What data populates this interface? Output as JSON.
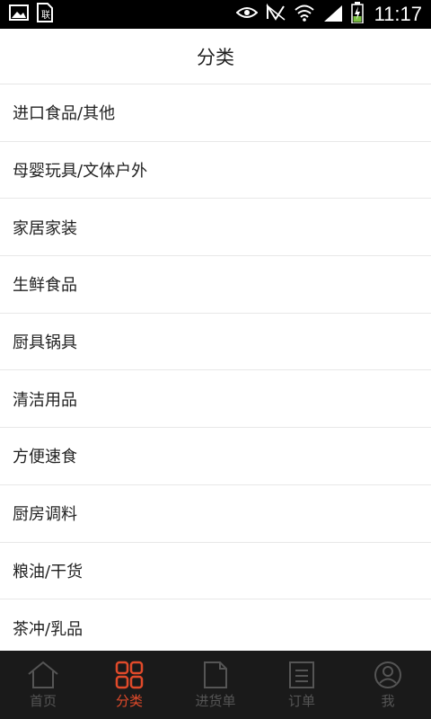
{
  "status_bar": {
    "time": "11:17",
    "icons": [
      "image-icon",
      "sim-icon",
      "eye-icon",
      "nfc-icon",
      "wifi-icon",
      "signal-icon",
      "battery-charging-icon"
    ]
  },
  "header": {
    "title": "分类"
  },
  "categories": [
    {
      "label": "进口食品/其他"
    },
    {
      "label": "母婴玩具/文体户外"
    },
    {
      "label": "家居家装"
    },
    {
      "label": "生鲜食品"
    },
    {
      "label": "厨具锅具"
    },
    {
      "label": "清洁用品"
    },
    {
      "label": "方便速食"
    },
    {
      "label": "厨房调料"
    },
    {
      "label": "粮油/干货"
    },
    {
      "label": "茶冲/乳品"
    }
  ],
  "tabs": [
    {
      "label": "首页",
      "icon": "home-icon",
      "active": false
    },
    {
      "label": "分类",
      "icon": "grid-icon",
      "active": true
    },
    {
      "label": "进货单",
      "icon": "document-icon",
      "active": false
    },
    {
      "label": "订单",
      "icon": "list-icon",
      "active": false
    },
    {
      "label": "我",
      "icon": "user-icon",
      "active": false
    }
  ],
  "colors": {
    "active_tab": "#e14a2a",
    "inactive_tab": "#555555",
    "tab_bar_bg": "#1a1a1a",
    "status_bar_bg": "#000000"
  }
}
